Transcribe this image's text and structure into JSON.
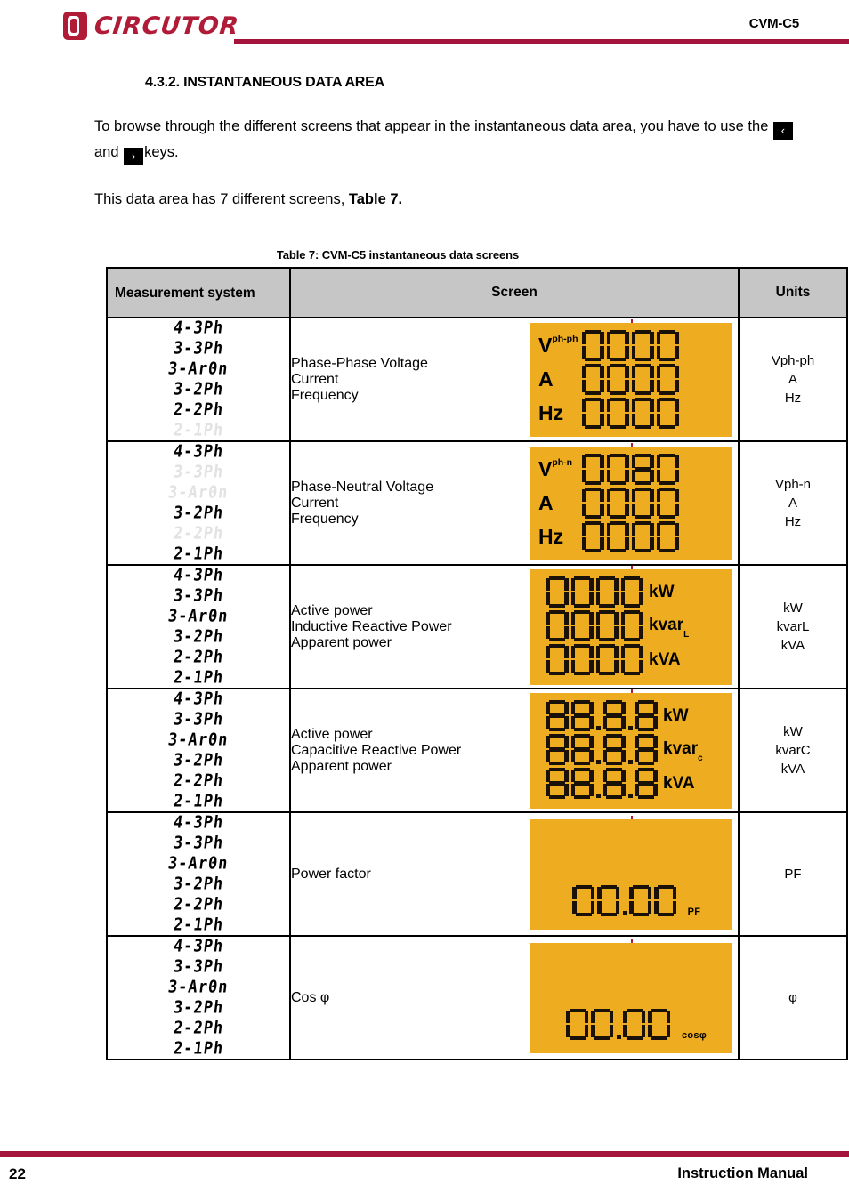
{
  "header": {
    "brand": "CIRCUTOR",
    "document_title": "CVM-C5"
  },
  "section": {
    "heading": "4.3.2. INSTANTANEOUS DATA AREA",
    "paragraph_1_part_1": "To browse through the different screens that appear in the instantaneous data area, you have to use the",
    "key_prev": "‹",
    "paragraph_1_and": "and",
    "key_next": "›",
    "paragraph_1_part_2": "keys.",
    "paragraph_2_part_1": "This data area has 7 different screens,",
    "paragraph_2_ref": "Table 7."
  },
  "table": {
    "caption": "Table 7: CVM-C5 instantaneous data screens",
    "headers": {
      "measurement_system": "Measurement system",
      "screen": "Screen",
      "units": "Units"
    },
    "rows": [
      {
        "codes": [
          {
            "text": "4-3Ph",
            "dim": false
          },
          {
            "text": "3-3Ph",
            "dim": false
          },
          {
            "text": "3-Ar0n",
            "dim": false
          },
          {
            "text": "3-2Ph",
            "dim": false
          },
          {
            "text": "2-2Ph",
            "dim": false
          },
          {
            "text": "2-1Ph",
            "dim": true
          }
        ],
        "description": [
          "Phase-Phase Voltage",
          "Current",
          "Frequency"
        ],
        "screen": {
          "layout": "three-row-left-label",
          "lines": [
            {
              "label": "V",
              "sup": "ph-ph",
              "digits": "0000"
            },
            {
              "label": "A",
              "sup": "",
              "digits": "0000"
            },
            {
              "label": "Hz",
              "sup": "",
              "digits": "0000"
            }
          ]
        },
        "units": [
          "Vph-ph",
          "A",
          "Hz"
        ]
      },
      {
        "codes": [
          {
            "text": "4-3Ph",
            "dim": false
          },
          {
            "text": "3-3Ph",
            "dim": true
          },
          {
            "text": "3-Ar0n",
            "dim": true
          },
          {
            "text": "3-2Ph",
            "dim": false
          },
          {
            "text": "2-2Ph",
            "dim": true
          },
          {
            "text": "2-1Ph",
            "dim": false
          }
        ],
        "description": [
          "Phase-Neutral Voltage",
          "Current",
          "Frequency"
        ],
        "screen": {
          "layout": "three-row-left-label",
          "lines": [
            {
              "label": "V",
              "sup": "ph-n",
              "digits": "0080"
            },
            {
              "label": "A",
              "sup": "",
              "digits": "0000"
            },
            {
              "label": "Hz",
              "sup": "",
              "digits": "0000"
            }
          ]
        },
        "units": [
          "Vph-n",
          "A",
          "Hz"
        ]
      },
      {
        "codes": [
          {
            "text": "4-3Ph",
            "dim": false
          },
          {
            "text": "3-3Ph",
            "dim": false
          },
          {
            "text": "3-Ar0n",
            "dim": false
          },
          {
            "text": "3-2Ph",
            "dim": false
          },
          {
            "text": "2-2Ph",
            "dim": false
          },
          {
            "text": "2-1Ph",
            "dim": false
          }
        ],
        "description": [
          "Active power",
          "Inductive Reactive Power",
          "Apparent power"
        ],
        "screen": {
          "layout": "three-row-right-label",
          "lines": [
            {
              "digits": "0000",
              "decimals": "",
              "label": "kW",
              "sub": ""
            },
            {
              "digits": "0000",
              "decimals": "",
              "label": "kvar",
              "sub": "L"
            },
            {
              "digits": "0000",
              "decimals": "",
              "label": "kVA",
              "sub": ""
            }
          ]
        },
        "units": [
          "kW",
          "kvarL",
          "kVA"
        ]
      },
      {
        "codes": [
          {
            "text": "4-3Ph",
            "dim": false
          },
          {
            "text": "3-3Ph",
            "dim": false
          },
          {
            "text": "3-Ar0n",
            "dim": false
          },
          {
            "text": "3-2Ph",
            "dim": false
          },
          {
            "text": "2-2Ph",
            "dim": false
          },
          {
            "text": "2-1Ph",
            "dim": false
          }
        ],
        "description": [
          "Active power",
          "Capacitive Reactive Power",
          "Apparent power"
        ],
        "screen": {
          "layout": "three-row-right-label",
          "lines": [
            {
              "digits": "8888",
              "decimals": "0110",
              "label": "kW",
              "sub": ""
            },
            {
              "digits": "8888",
              "decimals": "0110",
              "label": "kvar",
              "sub": "c"
            },
            {
              "digits": "8888",
              "decimals": "0110",
              "label": "kVA",
              "sub": ""
            }
          ]
        },
        "units": [
          "kW",
          "kvarC",
          "kVA"
        ]
      },
      {
        "codes": [
          {
            "text": "4-3Ph",
            "dim": false
          },
          {
            "text": "3-3Ph",
            "dim": false
          },
          {
            "text": "3-Ar0n",
            "dim": false
          },
          {
            "text": "3-2Ph",
            "dim": false
          },
          {
            "text": "2-2Ph",
            "dim": false
          },
          {
            "text": "2-1Ph",
            "dim": false
          }
        ],
        "description": [
          "Power factor"
        ],
        "screen": {
          "layout": "single-bottom",
          "digits": "0000",
          "decimals": "0100",
          "badge": "PF"
        },
        "units": [
          "PF"
        ]
      },
      {
        "codes": [
          {
            "text": "4-3Ph",
            "dim": false
          },
          {
            "text": "3-3Ph",
            "dim": false
          },
          {
            "text": "3-Ar0n",
            "dim": false
          },
          {
            "text": "3-2Ph",
            "dim": false
          },
          {
            "text": "2-2Ph",
            "dim": false
          },
          {
            "text": "2-1Ph",
            "dim": false
          }
        ],
        "description": [
          "Cos φ"
        ],
        "screen": {
          "layout": "single-bottom",
          "digits": "0000",
          "decimals": "0100",
          "badge": "cosφ"
        },
        "units": [
          "φ"
        ]
      }
    ]
  },
  "footer": {
    "page_number": "22",
    "manual_label": "Instruction Manual"
  },
  "colors": {
    "brand_red": "#a4143c",
    "lcd_amber": "#eeac20",
    "header_grey": "#c6c6c6"
  }
}
